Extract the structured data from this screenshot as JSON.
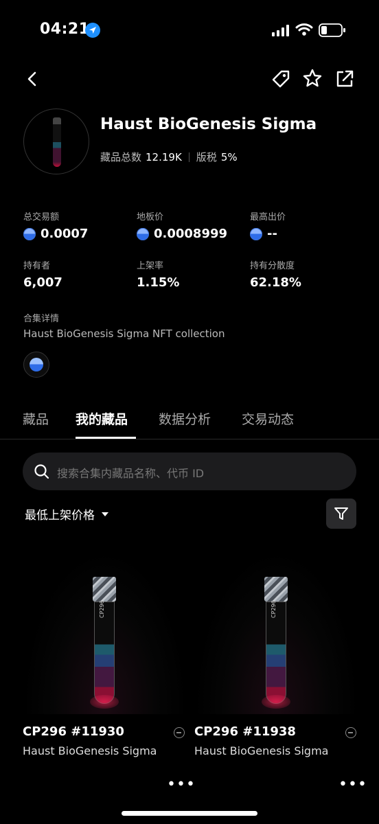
{
  "status_bar": {
    "time": "04:21"
  },
  "header": {
    "title": "Haust BioGenesis Sigma",
    "items_label": "藏品总数",
    "items_value": "12.19K",
    "royalty_label": "版税",
    "royalty_value": "5%"
  },
  "stats": [
    {
      "label": "总交易额",
      "value": "0.0007",
      "coin": true
    },
    {
      "label": "地板价",
      "value": "0.0008999",
      "coin": true
    },
    {
      "label": "最高出价",
      "value": "--",
      "coin": true
    },
    {
      "label": "持有者",
      "value": "6,007",
      "coin": false
    },
    {
      "label": "上架率",
      "value": "1.15%",
      "coin": false
    },
    {
      "label": "持有分散度",
      "value": "62.18%",
      "coin": false
    }
  ],
  "details": {
    "label": "合集详情",
    "text": "Haust BioGenesis Sigma NFT collection"
  },
  "tabs": [
    {
      "label": "藏品",
      "active": false
    },
    {
      "label": "我的藏品",
      "active": true
    },
    {
      "label": "数据分析",
      "active": false
    },
    {
      "label": "交易动态",
      "active": false
    }
  ],
  "search": {
    "placeholder": "搜索合集内藏品名称、代币 ID"
  },
  "sort": {
    "label": "最低上架价格"
  },
  "cards": [
    {
      "name": "CP296 #11930",
      "collection": "Haust BioGenesis Sigma",
      "tube_text": "CP296"
    },
    {
      "name": "CP296 #11938",
      "collection": "Haust BioGenesis Sigma",
      "tube_text": "CP296"
    }
  ],
  "colors": {
    "accent_coin": "#2f6de8",
    "location": "#1e90ff"
  },
  "icons": [
    "location-arrow-icon",
    "signal-icon",
    "wifi-icon",
    "battery-icon",
    "back-icon",
    "tag-icon",
    "star-icon",
    "share-icon",
    "search-icon",
    "filter-icon",
    "more-icon"
  ]
}
